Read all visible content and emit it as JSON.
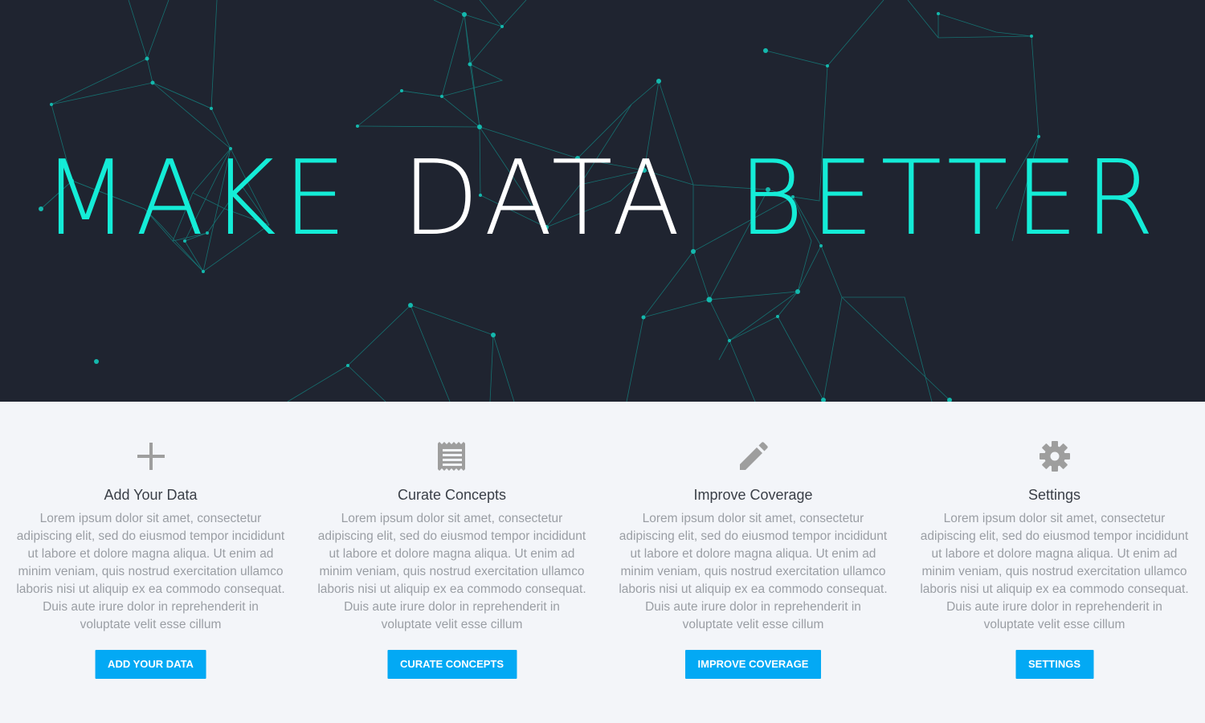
{
  "hero": {
    "title_word_1": "MAKE",
    "title_word_2": "DATA",
    "title_word_3": "BETTER",
    "accent_color": "#14ecd7",
    "background_color": "#1f2430"
  },
  "features": [
    {
      "icon": "plus-icon",
      "title": "Add Your Data",
      "description": "Lorem ipsum dolor sit amet, consectetur adipiscing elit, sed do eiusmod tempor incididunt ut labore et dolore magna aliqua. Ut enim ad minim veniam, quis nostrud exercitation ullamco laboris nisi ut aliquip ex ea commodo consequat. Duis aute irure dolor in reprehenderit in voluptate velit esse cillum",
      "button_label": "ADD YOUR DATA"
    },
    {
      "icon": "receipt-icon",
      "title": "Curate Concepts",
      "description": "Lorem ipsum dolor sit amet, consectetur adipiscing elit, sed do eiusmod tempor incididunt ut labore et dolore magna aliqua. Ut enim ad minim veniam, quis nostrud exercitation ullamco laboris nisi ut aliquip ex ea commodo consequat. Duis aute irure dolor in reprehenderit in voluptate velit esse cillum",
      "button_label": "CURATE CONCEPTS"
    },
    {
      "icon": "pencil-icon",
      "title": "Improve Coverage",
      "description": "Lorem ipsum dolor sit amet, consectetur adipiscing elit, sed do eiusmod tempor incididunt ut labore et dolore magna aliqua. Ut enim ad minim veniam, quis nostrud exercitation ullamco laboris nisi ut aliquip ex ea commodo consequat. Duis aute irure dolor in reprehenderit in voluptate velit esse cillum",
      "button_label": "IMPROVE COVERAGE"
    },
    {
      "icon": "gear-icon",
      "title": "Settings",
      "description": "Lorem ipsum dolor sit amet, consectetur adipiscing elit, sed do eiusmod tempor incididunt ut labore et dolore magna aliqua. Ut enim ad minim veniam, quis nostrud exercitation ullamco laboris nisi ut aliquip ex ea commodo consequat. Duis aute irure dolor in reprehenderit in voluptate velit esse cillum",
      "button_label": "SETTINGS"
    }
  ],
  "colors": {
    "button": "#03a9f4",
    "icon": "#9e9e9e",
    "page_background": "#f3f5f9"
  }
}
